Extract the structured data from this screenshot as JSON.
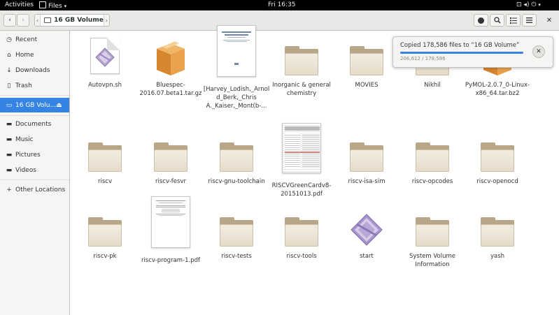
{
  "topbar": {
    "activities": "Activities",
    "app_menu": "Files",
    "clock": "Fri 16:35"
  },
  "header": {
    "location": "16 GB Volume"
  },
  "sidebar": {
    "items": [
      {
        "label": "Recent",
        "icon": "clock-icon"
      },
      {
        "label": "Home",
        "icon": "home-icon"
      },
      {
        "label": "Downloads",
        "icon": "download-icon"
      },
      {
        "label": "Trash",
        "icon": "trash-icon"
      },
      {
        "label": "16 GB Volu...",
        "icon": "drive-icon",
        "selected": true
      },
      {
        "label": "Documents",
        "icon": "folder-icon"
      },
      {
        "label": "Music",
        "icon": "folder-icon"
      },
      {
        "label": "Pictures",
        "icon": "folder-icon"
      },
      {
        "label": "Videos",
        "icon": "folder-icon"
      },
      {
        "label": "Other Locations",
        "icon": "plus-icon"
      }
    ]
  },
  "files": [
    {
      "name": "Autovpn.sh",
      "type": "script"
    },
    {
      "name": "Bluespec-2016.07.beta1.tar.gz",
      "type": "archive"
    },
    {
      "name": "[Harvey_Lodish,_Arnold_Berk,_Chris A._Kaiser,_Mont(b-...",
      "type": "pdf-book"
    },
    {
      "name": "Inorganic & general chemistry",
      "type": "folder"
    },
    {
      "name": "MOVIES",
      "type": "folder"
    },
    {
      "name": "Nikhil",
      "type": "folder"
    },
    {
      "name": "PyMOL-2.0.7_0-Linux-x86_64.tar.bz2",
      "type": "archive"
    },
    {
      "name": "riscv",
      "type": "folder"
    },
    {
      "name": "riscv-fesvr",
      "type": "folder"
    },
    {
      "name": "riscv-gnu-toolchain",
      "type": "folder"
    },
    {
      "name": "RISCVGreenCardv8-20151013.pdf",
      "type": "pdf-card"
    },
    {
      "name": "riscv-isa-sim",
      "type": "folder"
    },
    {
      "name": "riscv-opcodes",
      "type": "folder"
    },
    {
      "name": "riscv-openocd",
      "type": "folder"
    },
    {
      "name": "riscv-pk",
      "type": "folder"
    },
    {
      "name": "riscv-program-1.pdf",
      "type": "pdf-doc"
    },
    {
      "name": "riscv-tests",
      "type": "folder"
    },
    {
      "name": "riscv-tools",
      "type": "folder"
    },
    {
      "name": "start",
      "type": "script"
    },
    {
      "name": "System Volume Information",
      "type": "folder"
    },
    {
      "name": "yash",
      "type": "folder"
    }
  ],
  "notification": {
    "title": "Copied 178,586 files to “16 GB Volume”",
    "detail": "206,612 / 178,586",
    "progress": 1.0
  },
  "colors": {
    "accent": "#3584e4",
    "topbar": "#000000",
    "folder": "#b7a687"
  }
}
